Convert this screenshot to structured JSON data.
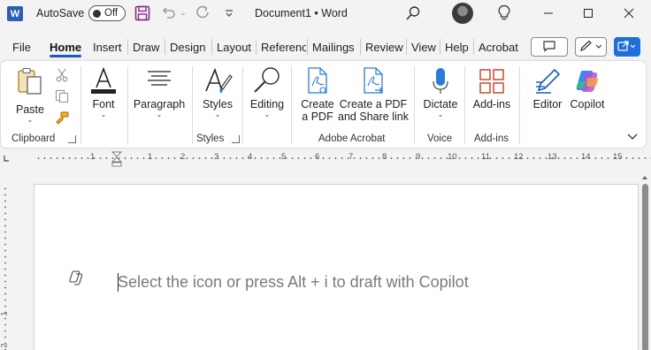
{
  "titlebar": {
    "app_logo_letter": "W",
    "autosave_label": "AutoSave",
    "autosave_state": "Off",
    "doc_title": "Document1 • Word"
  },
  "tabs": [
    "File",
    "Home",
    "Insert",
    "Draw",
    "Design",
    "Layout",
    "Referenc",
    "Mailings",
    "Review",
    "View",
    "Help",
    "Acrobat"
  ],
  "active_tab": "Home",
  "ribbon": {
    "clipboard": {
      "paste": "Paste",
      "group": "Clipboard"
    },
    "font": {
      "label": "Font"
    },
    "paragraph": {
      "label": "Paragraph"
    },
    "styles": {
      "label": "Styles",
      "group": "Styles"
    },
    "editing": {
      "label": "Editing"
    },
    "acrobat": {
      "create_pdf_l1": "Create",
      "create_pdf_l2": "a PDF",
      "create_share_l1": "Create a PDF",
      "create_share_l2": "and Share link",
      "group": "Adobe Acrobat"
    },
    "voice": {
      "dictate": "Dictate",
      "group": "Voice"
    },
    "addins": {
      "label": "Add-ins",
      "group": "Add-ins"
    },
    "editor": {
      "label": "Editor"
    },
    "copilot": {
      "label": "Copilot"
    }
  },
  "ruler": {
    "h_numbers": [
      "1",
      "1",
      "2",
      "3",
      "4",
      "5",
      "6",
      "7",
      "8",
      "9",
      "10",
      "11",
      "12",
      "13",
      "14",
      "15"
    ],
    "v_numbers": [
      "1",
      "2"
    ]
  },
  "document": {
    "placeholder": "Select the icon or press Alt + i to draft with Copilot"
  },
  "colors": {
    "accent": "#185abd",
    "share_button": "#1f6fd9",
    "word_blue": "#2b5fb3"
  },
  "icons": [
    "word-logo",
    "save-icon",
    "undo-icon",
    "redo-icon",
    "search-icon",
    "lightbulb-icon",
    "minimize-icon",
    "maximize-icon",
    "close-icon",
    "comment-icon",
    "pen-icon",
    "share-icon",
    "paste-icon",
    "cut-icon",
    "copy-icon",
    "format-painter-icon",
    "font-icon",
    "paragraph-icon",
    "styles-icon",
    "editing-icon",
    "create-pdf-icon",
    "create-pdf-share-icon",
    "microphone-icon",
    "addins-icon",
    "editor-icon",
    "copilot-icon",
    "collapse-ribbon-icon"
  ]
}
